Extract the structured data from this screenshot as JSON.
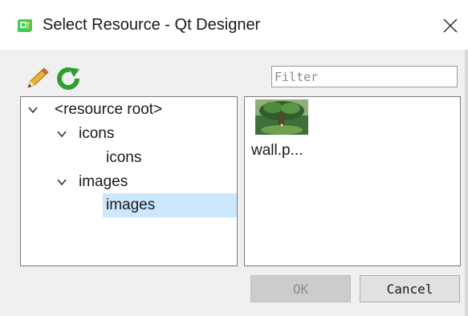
{
  "window": {
    "title": "Select Resource - Qt Designer",
    "close_glyph": "✕"
  },
  "toolbar": {
    "edit_icon": "pencil-icon",
    "reload_icon": "reload-icon",
    "filter_placeholder": "Filter",
    "filter_value": ""
  },
  "tree": {
    "items": [
      {
        "label": "<resource root>",
        "expanded": true,
        "level": 0
      },
      {
        "label": "icons",
        "expanded": true,
        "level": 1
      },
      {
        "label": "icons",
        "level": 2
      },
      {
        "label": "images",
        "expanded": true,
        "level": 1
      },
      {
        "label": "images",
        "level": 2,
        "selected": true
      }
    ]
  },
  "files": {
    "items": [
      {
        "label": "wall.p...",
        "thumbnail": "tree-landscape-thumbnail"
      }
    ]
  },
  "buttons": {
    "ok_label": "OK",
    "ok_enabled": false,
    "cancel_label": "Cancel"
  },
  "colors": {
    "selection": "#cce8ff",
    "reload_green": "#2f9e2f",
    "app_icon_green": "#41cd52"
  }
}
